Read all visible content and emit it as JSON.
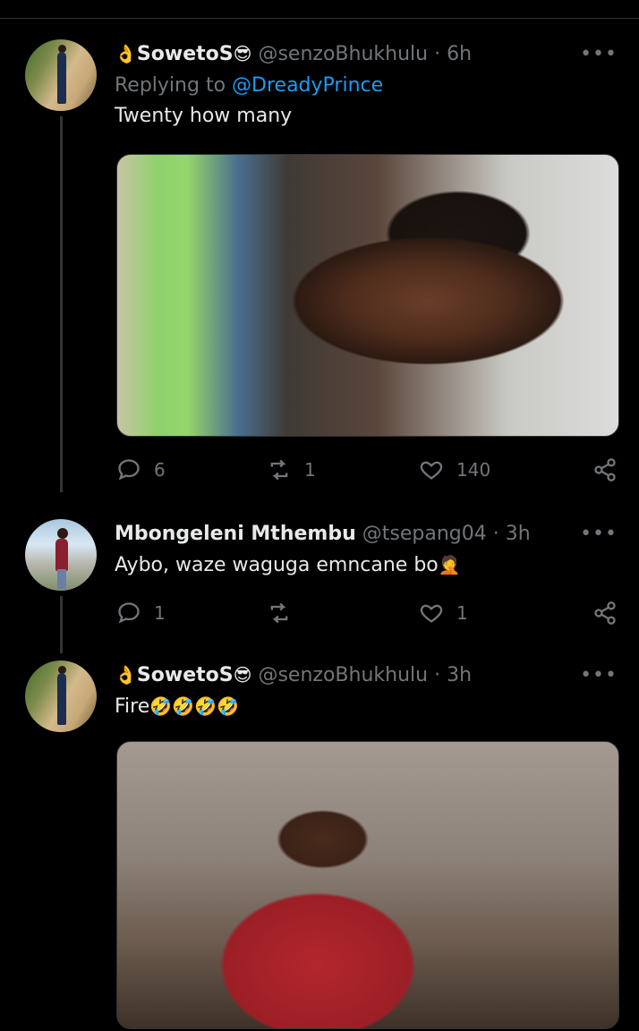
{
  "tweets": [
    {
      "display_name": "SowetoS",
      "name_prefix_emoji": "👌",
      "name_suffix_emoji": "😎",
      "handle": "@senzoBhukhulu",
      "separator": "·",
      "time": "6h",
      "replying_to_label": "Replying to",
      "replying_to_handle": "@DreadyPrince",
      "text": "Twenty how many",
      "text_emoji": "",
      "has_media": true,
      "actions": {
        "reply_count": "6",
        "retweet_count": "1",
        "like_count": "140"
      },
      "more_icon": "more-horizontal-icon"
    },
    {
      "display_name": "Mbongeleni Mthembu",
      "handle": "@tsepang04",
      "separator": "·",
      "time": "3h",
      "text": "Aybo, waze waguga emncane bo",
      "text_emoji": "🤦",
      "has_media": false,
      "actions": {
        "reply_count": "1",
        "retweet_count": "",
        "like_count": "1"
      },
      "more_icon": "more-horizontal-icon"
    },
    {
      "display_name": "SowetoS",
      "name_prefix_emoji": "👌",
      "name_suffix_emoji": "😎",
      "handle": "@senzoBhukhulu",
      "separator": "·",
      "time": "3h",
      "text": "Fire",
      "text_emoji": "🤣🤣🤣🤣",
      "has_media": true,
      "more_icon": "more-horizontal-icon"
    }
  ],
  "icons": {
    "reply": "reply-icon",
    "retweet": "retweet-icon",
    "like": "heart-icon",
    "share": "share-icon",
    "more": "more-icon"
  },
  "colors": {
    "background": "#000000",
    "text_primary": "#e7e9ea",
    "text_secondary": "#71767b",
    "link": "#1d9bf0",
    "divider": "#2f3336"
  }
}
